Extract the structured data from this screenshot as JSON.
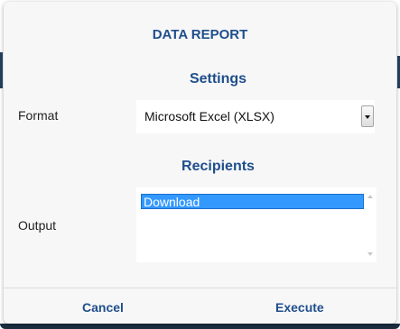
{
  "dialog": {
    "title": "DATA REPORT",
    "settings_heading": "Settings",
    "recipients_heading": "Recipients",
    "format": {
      "label": "Format",
      "selected": "Microsoft Excel (XLSX)"
    },
    "output": {
      "label": "Output",
      "items": [
        "Download"
      ]
    },
    "buttons": {
      "cancel": "Cancel",
      "execute": "Execute"
    }
  },
  "colors": {
    "accent": "#1f4e8c",
    "selection": "#3399ff",
    "dialog_background": "#f7f7f7"
  }
}
